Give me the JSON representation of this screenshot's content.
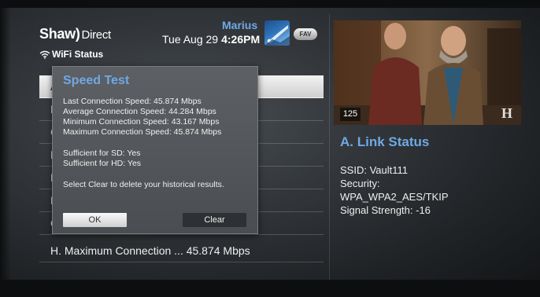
{
  "brand": {
    "name": "Shaw",
    "paren": ")",
    "suffix": "Direct"
  },
  "header": {
    "username": "Marius",
    "date": "Tue Aug 29",
    "time": "4:26PM",
    "fav_label": "FAV"
  },
  "section_title": "WiFi Status",
  "list": {
    "rows": [
      {
        "letter": "A",
        "label": "A"
      },
      {
        "letter": "B",
        "label": "B"
      },
      {
        "letter": "C",
        "label": "C"
      },
      {
        "letter": "D",
        "label": "D"
      },
      {
        "letter": "E",
        "label": "E"
      },
      {
        "letter": "F",
        "label": "F"
      },
      {
        "letter": "G",
        "label": "G"
      },
      {
        "letter": "H",
        "label": "H. Maximum Connection ... 45.874 Mbps"
      }
    ]
  },
  "preview": {
    "channel": "125",
    "watermark": "H"
  },
  "detail": {
    "title": "A. Link Status",
    "ssid": "SSID: Vault111",
    "security_label": "Security:",
    "security_value": "WPA_WPA2_AES/TKIP",
    "signal": "Signal Strength: -16"
  },
  "dialog": {
    "title": "Speed Test",
    "last": "Last Connection Speed: 45.874 Mbps",
    "average": "Average Connection Speed: 44.284 Mbps",
    "minimum": "Minimum Connection Speed: 43.167 Mbps",
    "maximum": "Maximum Connection Speed: 45.874 Mbps",
    "sd": "Sufficient for SD: Yes",
    "hd": "Sufficient for HD: Yes",
    "hint": "Select Clear to delete your historical results.",
    "ok_label": "OK",
    "clear_label": "Clear"
  },
  "colors": {
    "accent": "#6fa9e6",
    "panel": "#4a4d51"
  }
}
